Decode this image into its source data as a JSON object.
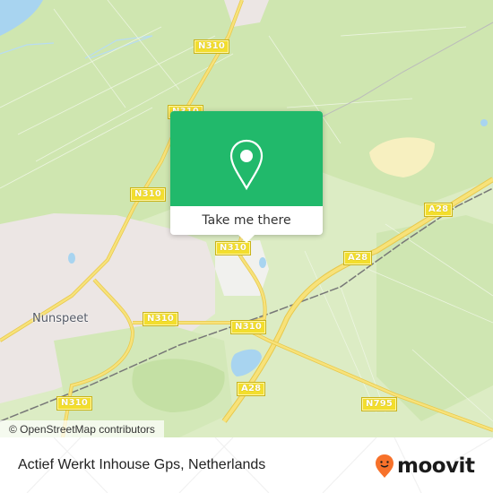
{
  "map": {
    "place_labels": [
      {
        "id": "nunspeet",
        "text": "Nunspeet"
      }
    ],
    "road_shields": [
      {
        "text": "N310"
      },
      {
        "text": "N310"
      },
      {
        "text": "N310"
      },
      {
        "text": "N310"
      },
      {
        "text": "N310"
      },
      {
        "text": "N310"
      },
      {
        "text": "A28"
      },
      {
        "text": "A28"
      },
      {
        "text": "A28"
      },
      {
        "text": "N795"
      }
    ],
    "attribution": "© OpenStreetMap contributors",
    "colors": {
      "land": "#dcecc4",
      "forest": "#c8e2a8",
      "urban": "#ece6e4",
      "water": "#a8d4f0",
      "road": "#f5e06a",
      "sand": "#f7f0c0"
    }
  },
  "popup": {
    "icon": "location-pin-icon",
    "button_label": "Take me there",
    "accent_color": "#21b96b"
  },
  "footer": {
    "title": "Actief Werkt Inhouse Gps, Netherlands",
    "brand": "moovit",
    "brand_color": "#f7712a"
  }
}
